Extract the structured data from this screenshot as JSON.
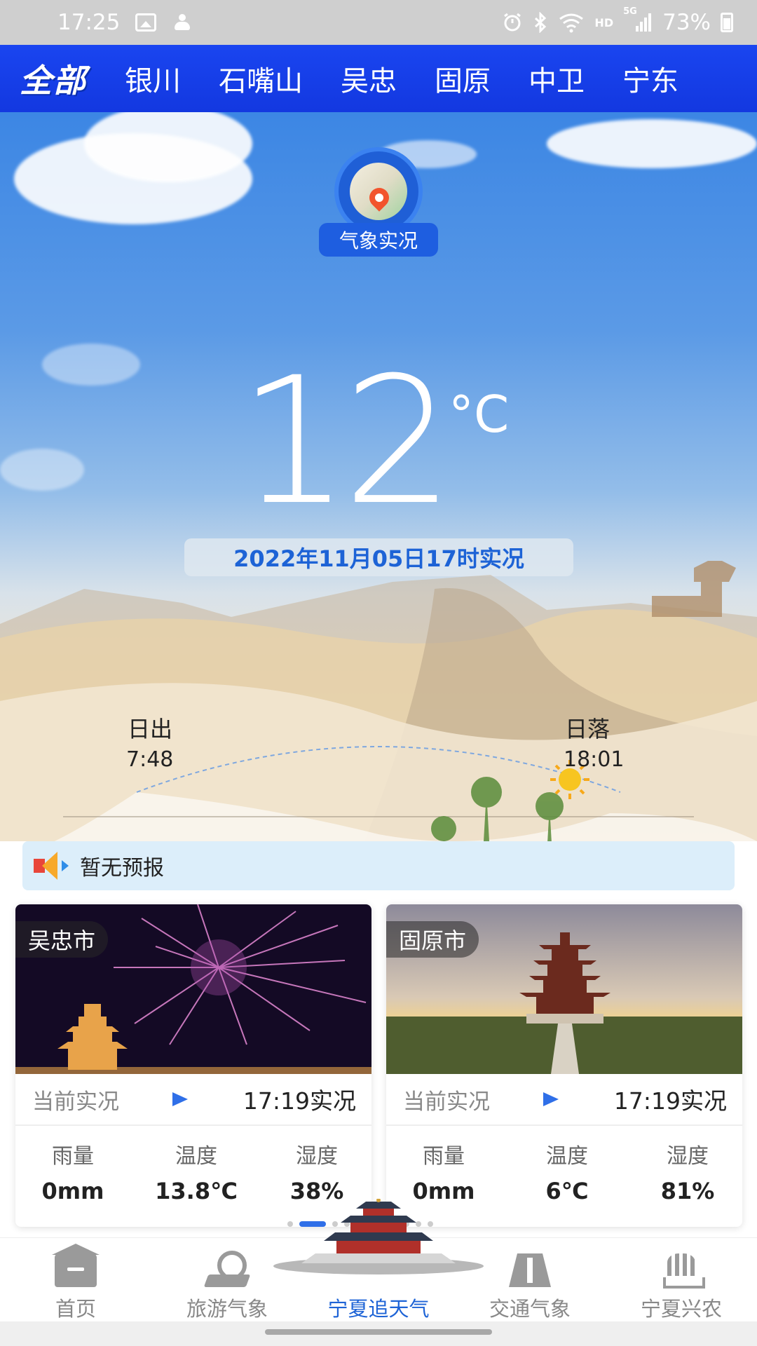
{
  "status_bar": {
    "time": "17:25",
    "hd_label": "HD",
    "network_label": "5G",
    "battery": "73%"
  },
  "top_tabs": [
    {
      "label": "全部",
      "active": true
    },
    {
      "label": "银川",
      "active": false
    },
    {
      "label": "石嘴山",
      "active": false
    },
    {
      "label": "吴忠",
      "active": false
    },
    {
      "label": "固原",
      "active": false
    },
    {
      "label": "中卫",
      "active": false
    },
    {
      "label": "宁东",
      "active": false
    }
  ],
  "hero": {
    "badge_label": "气象实况",
    "temperature": "12",
    "unit": "°C",
    "observation_time": "2022年11月05日17时实况",
    "sunrise_label": "日出",
    "sunrise_time": "7:48",
    "sunset_label": "日落",
    "sunset_time": "18:01"
  },
  "notice": {
    "icon": "speaker-icon",
    "text": "暂无预报"
  },
  "city_cards": [
    {
      "city": "吴忠市",
      "status_label": "当前实况",
      "time": "17:19实况",
      "headers": [
        "雨量",
        "温度",
        "湿度"
      ],
      "values": [
        "0mm",
        "13.8℃",
        "38%"
      ]
    },
    {
      "city": "固原市",
      "status_label": "当前实况",
      "time": "17:19实况",
      "headers": [
        "雨量",
        "温度",
        "湿度"
      ],
      "values": [
        "0mm",
        "6℃",
        "81%"
      ]
    }
  ],
  "carousel": {
    "count": 11,
    "active_index": 1
  },
  "bottom_nav": [
    {
      "label": "首页",
      "icon": "home-icon",
      "active": false
    },
    {
      "label": "旅游气象",
      "icon": "location-pin-icon",
      "active": false
    },
    {
      "label": "宁夏追天气",
      "icon": "temple-icon",
      "active": true
    },
    {
      "label": "交通气象",
      "icon": "road-icon",
      "active": false
    },
    {
      "label": "宁夏兴农",
      "icon": "wheat-icon",
      "active": false
    }
  ],
  "colors": {
    "nav_blue": "#1a45f0",
    "accent_blue": "#1d63d6",
    "notice_bg": "#dceefa"
  }
}
